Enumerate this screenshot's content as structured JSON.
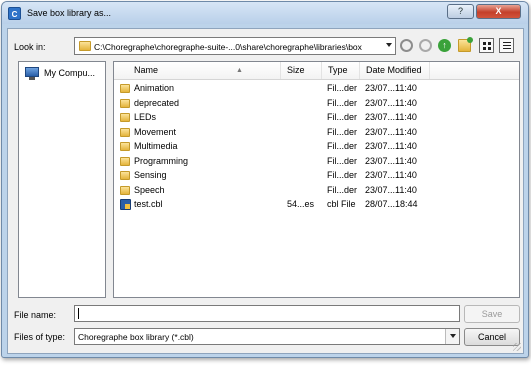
{
  "window": {
    "app_icon_letter": "C",
    "title": "Save box library as...",
    "help_glyph": "?",
    "close_glyph": "X"
  },
  "lookin": {
    "label": "Look in:",
    "path": "C:\\Choregraphe\\choregraphe-suite-...0\\share\\choregraphe\\libraries\\box"
  },
  "toolbar": {
    "icons": [
      "back-icon",
      "forward-icon",
      "up-folder-icon",
      "new-folder-icon",
      "detail-view-icon",
      "list-view-icon"
    ]
  },
  "sidebar": {
    "items": [
      {
        "label": "My Compu...",
        "icon": "computer-icon"
      }
    ]
  },
  "file_list": {
    "columns": [
      "Name",
      "Size",
      "Type",
      "Date Modified"
    ],
    "rows": [
      {
        "name": "Animation",
        "size": "",
        "type": "Fil...der",
        "date": "23/07...11:40",
        "icon": "folder-icon"
      },
      {
        "name": "deprecated",
        "size": "",
        "type": "Fil...der",
        "date": "23/07...11:40",
        "icon": "folder-icon"
      },
      {
        "name": "LEDs",
        "size": "",
        "type": "Fil...der",
        "date": "23/07...11:40",
        "icon": "folder-icon"
      },
      {
        "name": "Movement",
        "size": "",
        "type": "Fil...der",
        "date": "23/07...11:40",
        "icon": "folder-icon"
      },
      {
        "name": "Multimedia",
        "size": "",
        "type": "Fil...der",
        "date": "23/07...11:40",
        "icon": "folder-icon"
      },
      {
        "name": "Programming",
        "size": "",
        "type": "Fil...der",
        "date": "23/07...11:40",
        "icon": "folder-icon"
      },
      {
        "name": "Sensing",
        "size": "",
        "type": "Fil...der",
        "date": "23/07...11:40",
        "icon": "folder-icon"
      },
      {
        "name": "Speech",
        "size": "",
        "type": "Fil...der",
        "date": "23/07...11:40",
        "icon": "folder-icon"
      },
      {
        "name": "test.cbl",
        "size": "54...es",
        "type": "cbl File",
        "date": "28/07...18:44",
        "icon": "cbl-file-icon"
      }
    ]
  },
  "filename": {
    "label": "File name:",
    "value": ""
  },
  "filetype": {
    "label": "Files of type:",
    "selected": "Choregraphe box library (*.cbl)"
  },
  "buttons": {
    "save": "Save",
    "cancel": "Cancel"
  },
  "colors": {
    "frame": "#bcd3ea",
    "close_button": "#c4402b",
    "folder": "#e4b43c"
  }
}
